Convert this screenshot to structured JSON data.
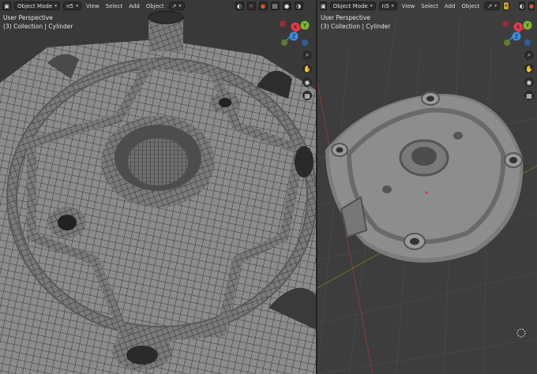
{
  "left_viewport": {
    "mode": "Object Mode",
    "menus": [
      "View",
      "Select",
      "Add",
      "Object"
    ],
    "info_line1": "User Perspective",
    "info_line2": "(3) Collection | Cylinder"
  },
  "right_viewport": {
    "mode": "Object Mode",
    "menus": [
      "View",
      "Select",
      "Add",
      "Object"
    ],
    "info_line1": "User Perspective",
    "info_line2": "(3) Collection | Cylinder"
  },
  "gizmo_labels": {
    "x": "X",
    "y": "Y",
    "z": "Z"
  },
  "colors": {
    "x_axis": "#e8394f",
    "y_axis": "#7fb62d",
    "z_axis": "#3b8fe6",
    "mesh": "#8a8a8a",
    "wire": "#1c1c1c"
  }
}
